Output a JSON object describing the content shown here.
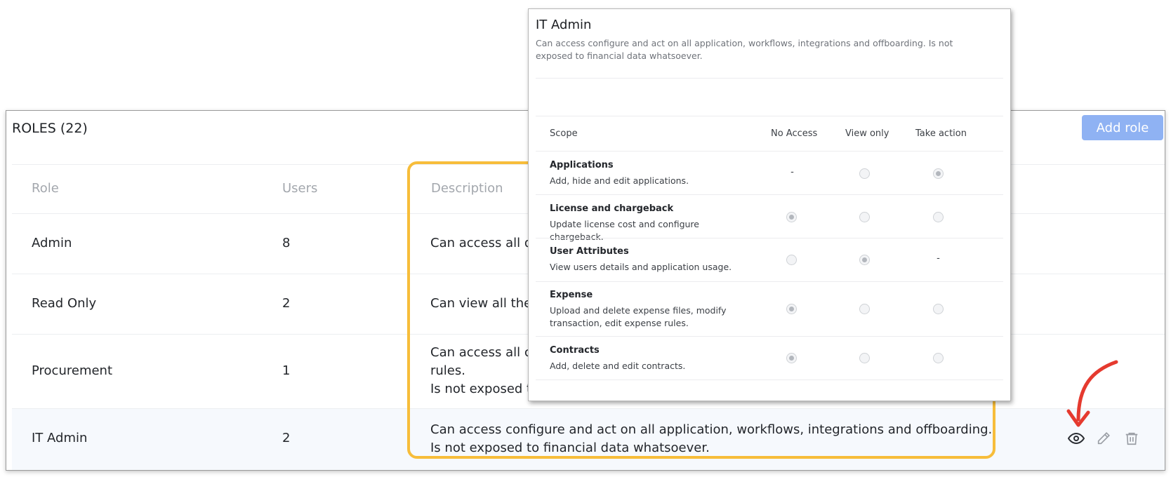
{
  "roles": {
    "title": "ROLES (22)",
    "add_role_label": "Add role",
    "columns": {
      "role": "Role",
      "users": "Users",
      "description": "Description"
    },
    "rows": [
      {
        "role": "Admin",
        "users": "8",
        "description": [
          "Can access all da"
        ]
      },
      {
        "role": "Read Only",
        "users": "2",
        "description": [
          "Can view all the c"
        ]
      },
      {
        "role": "Procurement",
        "users": "1",
        "description": [
          "Can access all co",
          "rules.",
          "Is not exposed to"
        ]
      },
      {
        "role": "IT Admin",
        "users": "2",
        "description": [
          "Can access configure and act on all application, workflows, integrations and offboarding.",
          "Is not exposed to financial data whatsoever."
        ]
      }
    ],
    "actions": [
      "eye-icon",
      "pencil-icon",
      "trash-icon"
    ]
  },
  "popup": {
    "title": "IT Admin",
    "description": "Can access configure and act on all application, workflows, integrations and offboarding. Is not exposed to financial data whatsoever.",
    "columns": {
      "scope": "Scope",
      "no_access": "No Access",
      "view_only": "View only",
      "take_action": "Take action"
    },
    "scopes": [
      {
        "name": "Applications",
        "desc": "Add, hide and edit applications.",
        "no_access": "-",
        "view_only": "unchecked",
        "take_action": "checked"
      },
      {
        "name": "License and chargeback",
        "desc": "Update license cost and configure chargeback.",
        "no_access": "checked",
        "view_only": "unchecked",
        "take_action": "unchecked"
      },
      {
        "name": "User Attributes",
        "desc": "View users details and application usage.",
        "no_access": "unchecked",
        "view_only": "checked",
        "take_action": "-"
      },
      {
        "name": "Expense",
        "desc": "Upload and delete expense files, modify transaction, edit expense rules.",
        "no_access": "checked",
        "view_only": "unchecked",
        "take_action": "unchecked"
      },
      {
        "name": "Contracts",
        "desc": "Add, delete and edit contracts.",
        "no_access": "checked",
        "view_only": "unchecked",
        "take_action": "unchecked"
      }
    ]
  },
  "colors": {
    "accent": "#8fb2f3",
    "highlight": "#f7bd3a",
    "arrow": "#e53a2f"
  }
}
